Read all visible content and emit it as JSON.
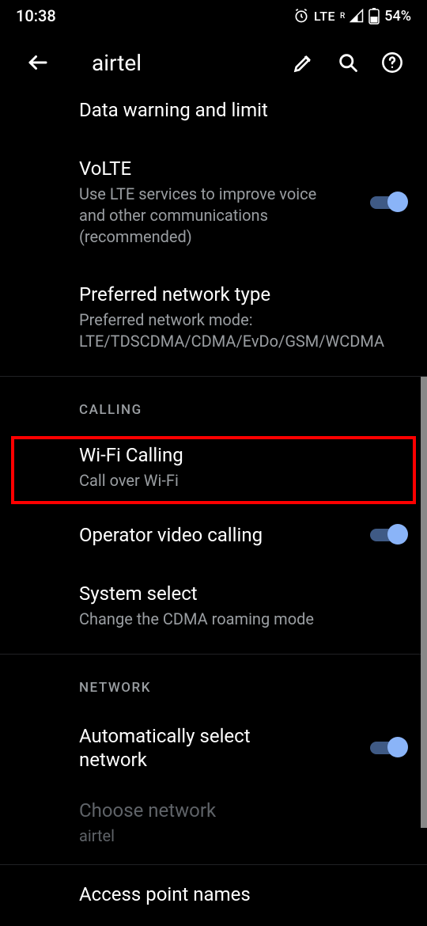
{
  "status": {
    "time": "10:38",
    "lte": "LTE",
    "roam": "R",
    "battery": "54%"
  },
  "app_bar": {
    "title": "airtel"
  },
  "items": {
    "data_warning": {
      "title": "Data warning and limit"
    },
    "volte": {
      "title": "VoLTE",
      "sub": "Use LTE services to improve voice and other communications (recommended)"
    },
    "pref_net": {
      "title": "Preferred network type",
      "sub": "Preferred network mode: LTE/TDSCDMA/CDMA/EvDo/GSM/WCDMA"
    },
    "wifi_call": {
      "title": "Wi-Fi Calling",
      "sub": "Call over Wi-Fi"
    },
    "op_video": {
      "title": "Operator video calling"
    },
    "sys_select": {
      "title": "System select",
      "sub": "Change the CDMA roaming mode"
    },
    "auto_net": {
      "title": "Automatically select network"
    },
    "choose_net": {
      "title": "Choose network",
      "sub": "airtel"
    },
    "apn": {
      "title": "Access point names"
    }
  },
  "sections": {
    "calling": "CALLING",
    "network": "NETWORK"
  }
}
